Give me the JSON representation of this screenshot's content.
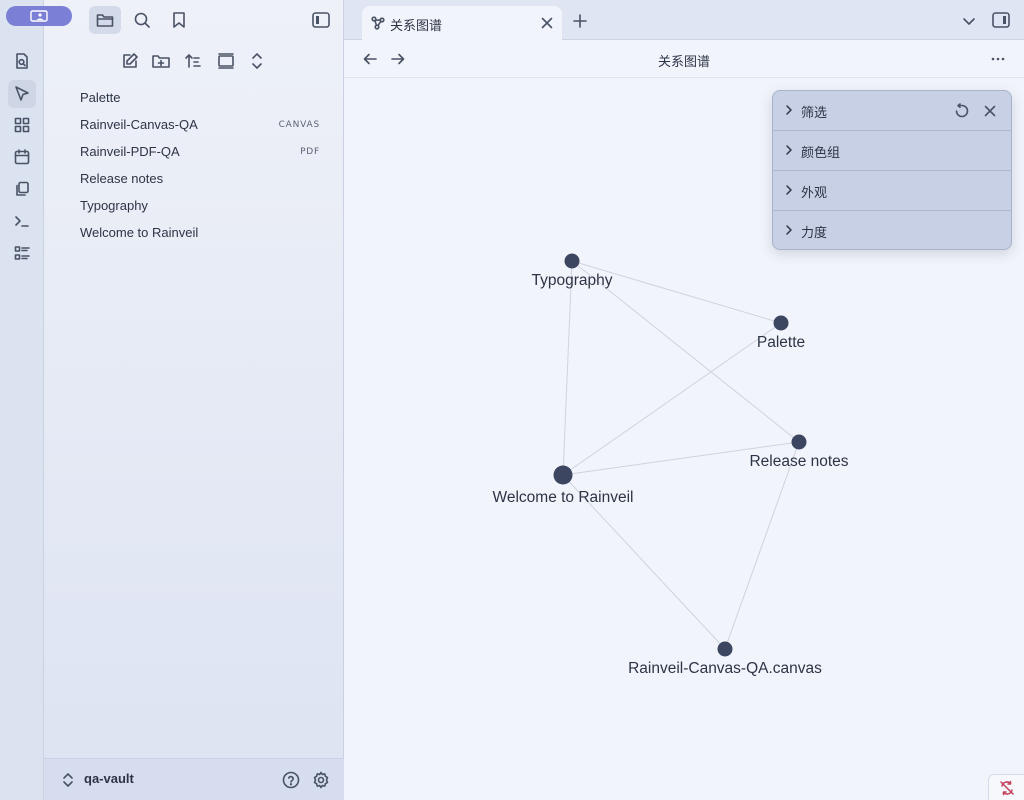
{
  "sidebar": {
    "files": [
      {
        "name": "Palette",
        "tag": ""
      },
      {
        "name": "Rainveil-Canvas-QA",
        "tag": "CANVAS"
      },
      {
        "name": "Rainveil-PDF-QA",
        "tag": "PDF"
      },
      {
        "name": "Release notes",
        "tag": ""
      },
      {
        "name": "Typography",
        "tag": ""
      },
      {
        "name": "Welcome to Rainveil",
        "tag": ""
      }
    ],
    "vault_name": "qa-vault"
  },
  "tab": {
    "title": "关系图谱"
  },
  "view": {
    "title": "关系图谱"
  },
  "controls": {
    "sections": [
      "筛选",
      "颜色组",
      "外观",
      "力度"
    ]
  },
  "graph": {
    "nodes": [
      {
        "id": "typography",
        "label": "Typography"
      },
      {
        "id": "palette",
        "label": "Palette"
      },
      {
        "id": "release",
        "label": "Release notes"
      },
      {
        "id": "welcome",
        "label": "Welcome to Rainveil"
      },
      {
        "id": "canvas",
        "label": "Rainveil-Canvas-QA.canvas"
      }
    ],
    "edges": [
      [
        "typography",
        "palette"
      ],
      [
        "typography",
        "release"
      ],
      [
        "typography",
        "welcome"
      ],
      [
        "palette",
        "welcome"
      ],
      [
        "welcome",
        "release"
      ],
      [
        "welcome",
        "canvas"
      ],
      [
        "release",
        "canvas"
      ]
    ],
    "colors": {
      "node": "#3c4661",
      "edge": "#cfd3dc"
    }
  }
}
